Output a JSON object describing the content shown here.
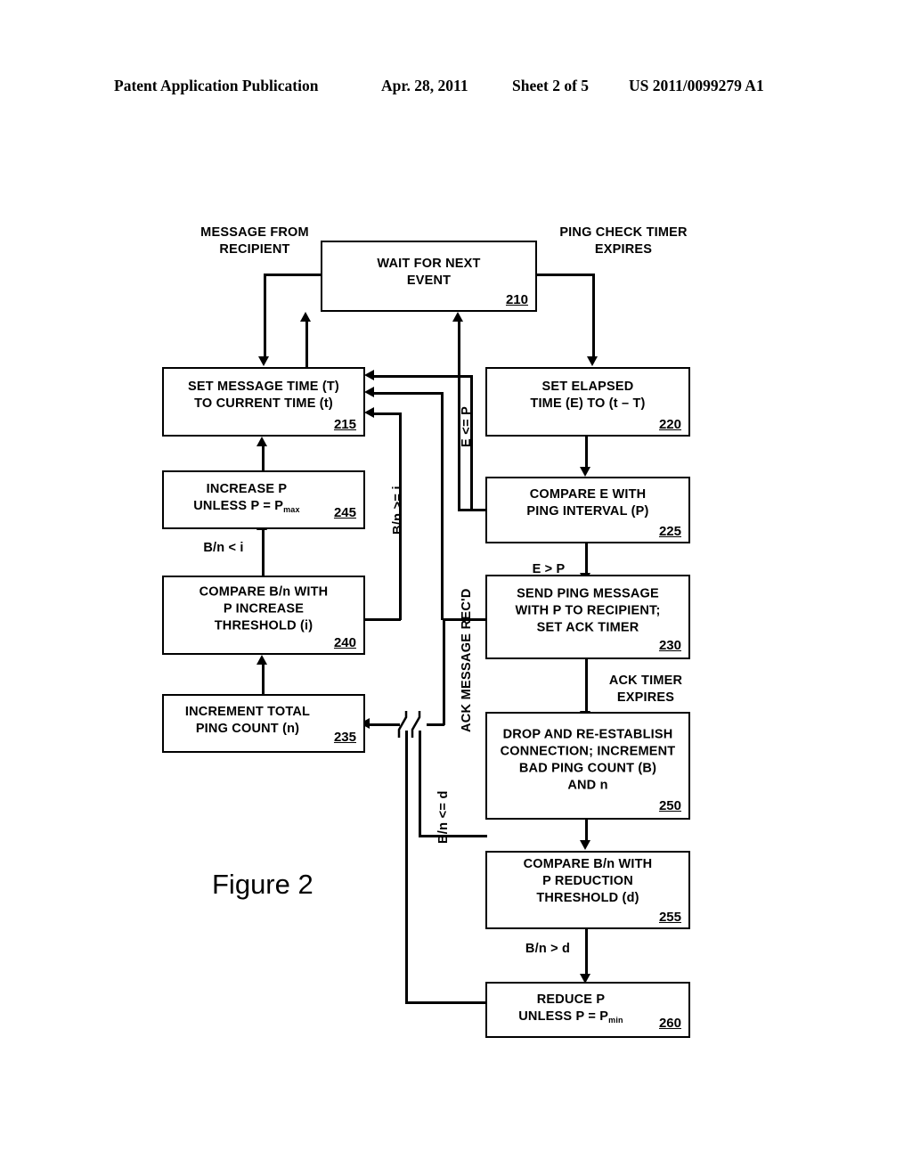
{
  "header": {
    "publication": "Patent Application Publication",
    "date": "Apr. 28, 2011",
    "sheet": "Sheet 2 of 5",
    "patent_number": "US 2011/0099279 A1"
  },
  "figure": {
    "caption": "Figure 2",
    "type": "flowchart",
    "boxes": [
      {
        "id": "210",
        "number": "210",
        "line1": "WAIT FOR NEXT",
        "line2": "EVENT",
        "line3": "",
        "line4": ""
      },
      {
        "id": "215",
        "number": "215",
        "line1": "SET MESSAGE TIME (T)",
        "line2": "TO CURRENT TIME (t)",
        "line3": "",
        "line4": ""
      },
      {
        "id": "220",
        "number": "220",
        "line1": "SET ELAPSED",
        "line2": "TIME (E) TO (t – T)",
        "line3": "",
        "line4": ""
      },
      {
        "id": "225",
        "number": "225",
        "line1": "COMPARE E WITH",
        "line2": "PING INTERVAL (P)",
        "line3": "",
        "line4": ""
      },
      {
        "id": "230",
        "number": "230",
        "line1": "SEND PING MESSAGE",
        "line2": "WITH P TO RECIPIENT;",
        "line3": "SET ACK TIMER",
        "line4": ""
      },
      {
        "id": "235",
        "number": "235",
        "line1": "INCREMENT TOTAL",
        "line2": "PING COUNT (n)",
        "line3": "",
        "line4": ""
      },
      {
        "id": "240",
        "number": "240",
        "line1": "COMPARE B/n WITH",
        "line2": "P INCREASE",
        "line3": "THRESHOLD (i)",
        "line4": ""
      },
      {
        "id": "245",
        "number": "245",
        "line1": "INCREASE P",
        "line2": "UNLESS P = Pmax",
        "line3": "",
        "line4": ""
      },
      {
        "id": "250",
        "number": "250",
        "line1": "DROP AND RE-ESTABLISH",
        "line2": "CONNECTION; INCREMENT",
        "line3": "BAD PING COUNT (B)",
        "line4": "AND n"
      },
      {
        "id": "255",
        "number": "255",
        "line1": "COMPARE B/n WITH",
        "line2": "P REDUCTION",
        "line3": "THRESHOLD (d)",
        "line4": ""
      },
      {
        "id": "260",
        "number": "260",
        "line1": "REDUCE P",
        "line2": "UNLESS P = Pmin",
        "line3": "",
        "line4": ""
      }
    ],
    "labels": {
      "message_from_recipient": "MESSAGE FROM\nRECIPIENT",
      "ping_check_timer_expires": "PING CHECK TIMER\nEXPIRES",
      "e_gt_p": "E > P",
      "ack_timer_expires": "ACK TIMER\nEXPIRES",
      "bn_lt_i": "B/n < i",
      "bn_gt_d": "B/n > d",
      "e_le_p": "E <= P",
      "bn_ge_i": "B/n >= i",
      "ack_message_recd": "ACK MESSAGE REC'D",
      "bn_le_d": "B/n <= d"
    }
  }
}
